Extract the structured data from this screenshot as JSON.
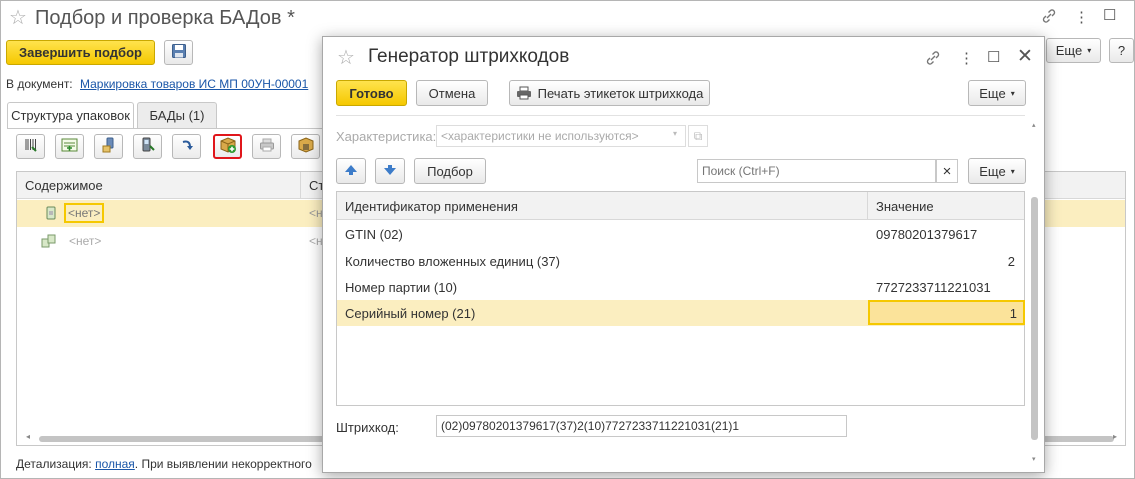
{
  "main": {
    "title": "Подбор и проверка БАДов *",
    "finish_label": "Завершить подбор",
    "more_label": "Еще",
    "help_label": "?",
    "doc_label": "В документ:",
    "doc_link": "Маркировка товаров ИС МП 00УН-00001",
    "tabs": [
      {
        "label": "Структура упаковок"
      },
      {
        "label": "БАДы (1)"
      }
    ],
    "grid": {
      "col_content": "Содержимое",
      "col_second": "Ст",
      "rows": [
        {
          "content": "<нет>",
          "second": "<н"
        },
        {
          "content": "<нет>",
          "second": "<н"
        }
      ]
    },
    "footer": {
      "prefix": "Детализация:",
      "link": "полная",
      "text": ". При выявлении некорректного"
    },
    "icons": [
      "barcode-scan-icon",
      "add-row-icon",
      "scanner-icon",
      "tsd-icon",
      "arrow-icon",
      "add-package-icon",
      "print-icon",
      "box-barcode-icon"
    ]
  },
  "dialog": {
    "title": "Генератор штрихкодов",
    "ok_label": "Готово",
    "cancel_label": "Отмена",
    "print_label": "Печать этикеток штрихкода",
    "more_label": "Еще",
    "char_label": "Характеристика:",
    "char_placeholder": "<характеристики не используются>",
    "pick_label": "Подбор",
    "search_placeholder": "Поиск (Ctrl+F)",
    "search_clear": "×",
    "table": {
      "col_id": "Идентификатор применения",
      "col_value": "Значение",
      "rows": [
        {
          "id": "GTIN (02)",
          "value": "09780201379617",
          "align": "left"
        },
        {
          "id": "Количество вложенных единиц (37)",
          "value": "2",
          "align": "right"
        },
        {
          "id": "Номер партии (10)",
          "value": "7727233711221031",
          "align": "left"
        },
        {
          "id": "Серийный номер (21)",
          "value": "1",
          "align": "right"
        }
      ]
    },
    "barcode_label": "Штрихкод:",
    "barcode_value": "(02)09780201379617(37)2(10)7727233711221031(21)1"
  },
  "colors": {
    "accent_yellow": "#f5c800",
    "selection": "#fbeec0",
    "highlight_red": "#e0161b",
    "link": "#1a56a8"
  }
}
